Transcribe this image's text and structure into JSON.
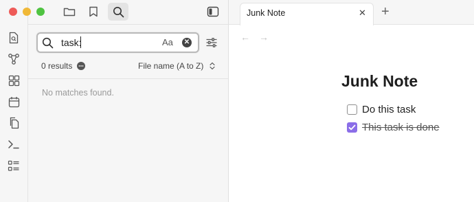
{
  "window": {
    "traffic_lights": {
      "close": "#ee5b58",
      "minimize": "#f0b837",
      "maximize": "#4fc341"
    }
  },
  "toolbar": {
    "icons": [
      "folder-icon",
      "bookmark-icon",
      "search-icon",
      "sidebar-toggle-icon"
    ]
  },
  "ribbon": {
    "icons": [
      "quick-switcher-icon",
      "graph-view-icon",
      "canvas-icon",
      "daily-note-icon",
      "templates-icon",
      "command-palette-icon",
      "bases-icon"
    ]
  },
  "search": {
    "value": "task:",
    "match_case_label": "Aa",
    "clear_glyph": "✕",
    "results_label": "0 results",
    "sort_label": "File name (A to Z)",
    "sort_glyph": "⌃⌄",
    "empty_message": "No matches found."
  },
  "tabs": {
    "items": [
      {
        "label": "Junk Note",
        "close": "✕"
      }
    ],
    "new_tab": "+"
  },
  "nav": {
    "back": "←",
    "forward": "→"
  },
  "note": {
    "title": "Junk Note",
    "tasks": [
      {
        "label": "Do this task",
        "done": false
      },
      {
        "label": "This task is done",
        "done": true
      }
    ]
  },
  "colors": {
    "accent": "#8b6ee8",
    "panel_bg": "#f6f6f6",
    "editor_bg": "#ffffff"
  }
}
